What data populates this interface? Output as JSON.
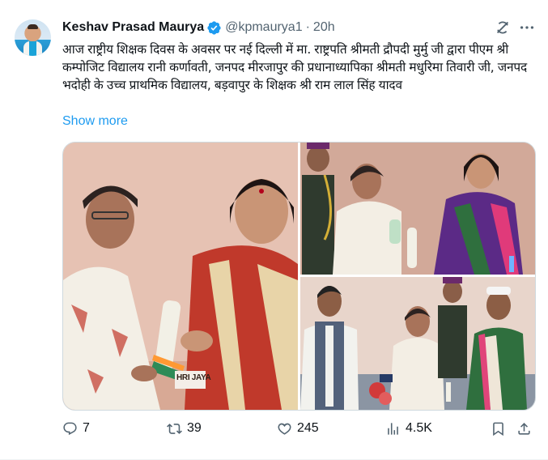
{
  "author": {
    "name": "Keshav Prasad Maurya",
    "handle": "@kpmaurya1",
    "separator": "·",
    "time": "20h",
    "verified": true
  },
  "post": {
    "text": "आज राष्ट्रीय शिक्षक दिवस के अवसर पर नई दिल्ली में मा. राष्ट्रपति श्रीमती द्रौपदी मुर्मु जी द्वारा पीएम श्री कम्पोजिट विद्यालय रानी कर्णावती, जनपद मीरजापुर की प्रधानाध्यापिका श्रीमती मधुरिमा तिवारी जी, जनपद भदोही के उच्च प्राथमिक विद्यालय, बड़वापुर के शिक्षक श्री राम लाल सिंह यादव",
    "show_more": "Show more",
    "media": {
      "photo1_sign": "HRI JAYA"
    }
  },
  "actions": {
    "replies": "7",
    "reposts": "39",
    "likes": "245",
    "views": "4.5K"
  },
  "icons": [
    "verified-badge-icon",
    "grok-icon",
    "more-icon",
    "reply-icon",
    "repost-icon",
    "like-icon",
    "views-icon",
    "bookmark-icon",
    "share-icon"
  ],
  "colors": {
    "accent": "#1d9bf0",
    "muted": "#536471",
    "text": "#0f1419"
  }
}
